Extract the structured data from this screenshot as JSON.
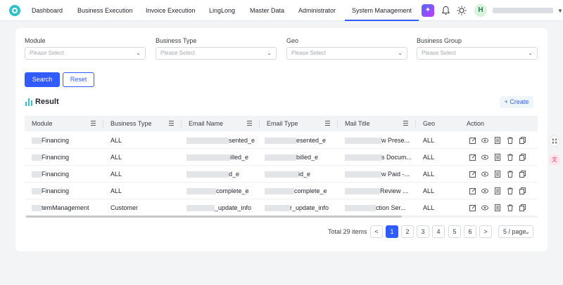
{
  "nav": {
    "items": [
      "Dashboard",
      "Business Execution",
      "Invoice Execution",
      "LingLong",
      "Master Data",
      "Administrator",
      "System Management"
    ],
    "active": "System Management",
    "avatar_letter": "H"
  },
  "filters": {
    "module_label": "Module",
    "business_type_label": "Business Type",
    "geo_label": "Geo",
    "business_group_label": "Business Group",
    "placeholder": "Please Select"
  },
  "buttons": {
    "search": "Search",
    "reset": "Reset",
    "create": "+ Create"
  },
  "result_title": "Result",
  "table": {
    "columns": [
      "Module",
      "Business Type",
      "Email Name",
      "Email Type",
      "Mail Title",
      "Geo",
      "Action"
    ],
    "rows": [
      {
        "module": "Financing",
        "business_type": "ALL",
        "email_name": "sented_e",
        "email_type": "esented_e",
        "mail_title": "w Prese...",
        "geo": "ALL"
      },
      {
        "module": "Financing",
        "business_type": "ALL",
        "email_name": "illed_e",
        "email_type": "billed_e",
        "mail_title": "s Docum...",
        "geo": "ALL"
      },
      {
        "module": "Financing",
        "business_type": "ALL",
        "email_name": "d_e",
        "email_type": "id_e",
        "mail_title": "w Paid -...",
        "geo": "ALL"
      },
      {
        "module": "Financing",
        "business_type": "ALL",
        "email_name": "complete_e",
        "email_type": "complete_e",
        "mail_title": "Review ...",
        "geo": "ALL"
      },
      {
        "module": "temManagement",
        "business_type": "Customer",
        "email_name": "_update_info",
        "email_type": "r_update_info",
        "mail_title": "ction Ser...",
        "geo": "ALL"
      }
    ]
  },
  "pagination": {
    "total": "Total 29 items",
    "pages": [
      "1",
      "2",
      "3",
      "4",
      "5",
      "6"
    ],
    "current": "1",
    "prev": "<",
    "next": ">",
    "page_size": "5 / page"
  },
  "colors": {
    "accent": "#2f5bff",
    "brand": "#2fc2c9"
  }
}
